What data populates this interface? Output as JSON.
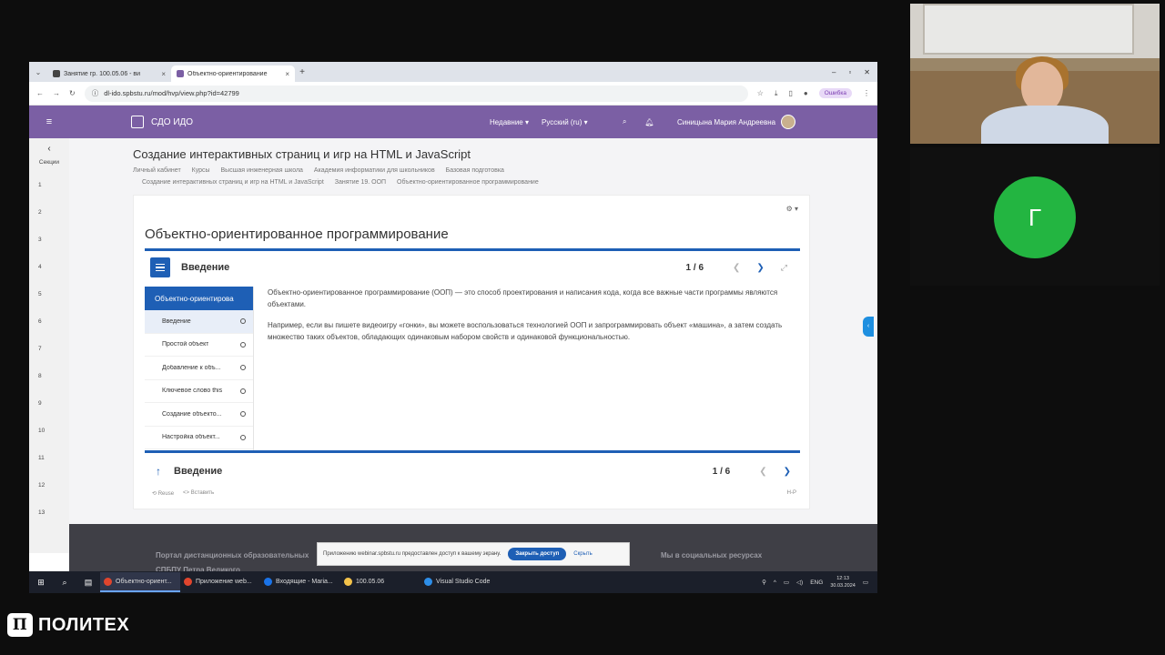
{
  "browser": {
    "tabs": [
      {
        "label": "Занятие гр. 100.05.06 - ви",
        "active": false
      },
      {
        "label": "Объектно-ориентирование",
        "active": true
      }
    ],
    "url": "dl-ido.spbstu.ru/mod/hvp/view.php?id=42799",
    "error_badge": "Ошибка"
  },
  "site": {
    "brand": "СДО ИДО",
    "recent": "Недавние",
    "language": "Русский (ru)",
    "user": "Синицына Мария Андреевна"
  },
  "rail": {
    "label": "Секции",
    "numbers": [
      "1",
      "2",
      "3",
      "4",
      "5",
      "6",
      "7",
      "8",
      "9",
      "10",
      "11",
      "12",
      "13"
    ]
  },
  "course": {
    "title": "Создание интерактивных страниц и игр на HTML и JavaScript",
    "breadcrumbs_line1": [
      "Личный кабинет",
      "Курсы",
      "Высшая инженерная школа",
      "Академия информатики для школьников",
      "Базовая подготовка"
    ],
    "breadcrumbs_line2": [
      "Создание интерактивных страниц и игр на HTML и JavaScript",
      "Занятие 19. ООП",
      "Объектно-ориентированное программирование"
    ]
  },
  "activity": {
    "page_title": "Объектно-ориентированное программирование",
    "header_title": "Введение",
    "counter": "1 / 6",
    "footer_title": "Введение",
    "footer_counter": "1 / 6",
    "toc_heading": "Объектно-ориентирова",
    "toc": [
      {
        "label": "Введение",
        "selected": true
      },
      {
        "label": "Простой объект",
        "selected": false
      },
      {
        "label": "Добавление к объ...",
        "selected": false
      },
      {
        "label": "Ключевое слово this",
        "selected": false
      },
      {
        "label": "Создание объекто...",
        "selected": false
      },
      {
        "label": "Настройка объект...",
        "selected": false
      }
    ],
    "paragraphs": [
      "Объектно-ориентированное программирование (ООП) — это способ проектирования и написания кода, когда все важные части программы являются объектами.",
      "Например, если вы пишете видеоигру «гонки», вы можете воспользоваться технологией ООП и запрограммировать объект «машина», а затем создать множество таких объектов, обладающих одинаковым набором свойств и одинаковой функциональностью."
    ],
    "reuse": "Reuse",
    "embed": "Вставить",
    "h5p": "H-P"
  },
  "footer": {
    "portal_line1": "Портал дистанционных образовательных",
    "portal_line2": "СПБПУ Петра Великого",
    "social": "Мы в социальных ресурсах"
  },
  "notification": {
    "text": "Приложению webinar.spbstu.ru предоставлен доступ к вашему экрану.",
    "button": "Закрыть доступ",
    "hide": "Скрыть"
  },
  "taskbar": {
    "apps": [
      {
        "label": "Объектно-ориент...",
        "color": "#e0452d",
        "active": true
      },
      {
        "label": "Приложение web...",
        "color": "#e0452d",
        "active": false
      },
      {
        "label": "Входящие - Maria...",
        "color": "#1a73e8",
        "active": false
      },
      {
        "label": "100.05.06",
        "color": "#f3c24a",
        "active": false
      },
      {
        "label": "Visual Studio Code",
        "color": "#2d8ee8",
        "active": false
      }
    ],
    "lang": "ENG",
    "time": "12:13",
    "date": "30.03.2024"
  },
  "participant": {
    "initial": "Г",
    "color": "#23b541"
  },
  "brand_corner": {
    "mark": "П",
    "text": "ПОЛИТЕХ"
  },
  "colors": {
    "accent": "#1e5fb5",
    "navbar": "#7b5fa4"
  }
}
